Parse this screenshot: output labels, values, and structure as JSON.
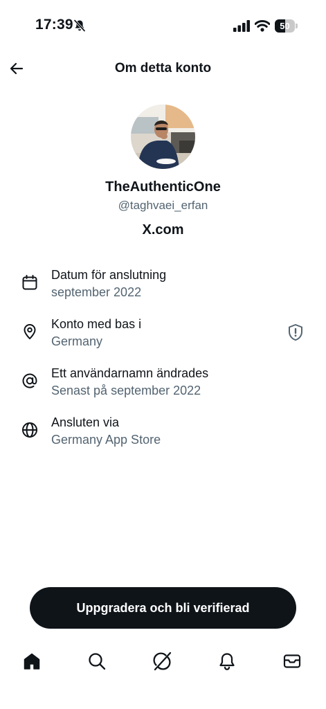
{
  "status_bar": {
    "time": "17:39",
    "battery_level": "50",
    "battery_fraction": 0.5,
    "icons": [
      "mute-bell-icon",
      "cellular-signal-icon",
      "wifi-icon",
      "battery-icon"
    ]
  },
  "header": {
    "title": "Om detta konto",
    "back_icon": "arrow-left-icon"
  },
  "profile": {
    "display_name": "TheAuthenticOne",
    "handle": "@taghvaei_erfan",
    "platform": "X.com"
  },
  "details": [
    {
      "icon": "calendar-icon",
      "title": "Datum för anslutning",
      "value": "september 2022"
    },
    {
      "icon": "location-pin-icon",
      "title": "Konto med bas i",
      "value": "Germany",
      "action_icon": "shield-alert-icon"
    },
    {
      "icon": "at-sign-icon",
      "title": "Ett användarnamn ändrades",
      "value": "Senast på september 2022"
    },
    {
      "icon": "globe-icon",
      "title": "Ansluten via",
      "value": "Germany App Store"
    }
  ],
  "cta": {
    "label": "Uppgradera och bli verifierad"
  },
  "bottom_nav": [
    {
      "icon": "home-icon",
      "active": true
    },
    {
      "icon": "search-icon",
      "active": false
    },
    {
      "icon": "grok-icon",
      "active": false
    },
    {
      "icon": "bell-icon",
      "active": false
    },
    {
      "icon": "mail-icon",
      "active": false
    }
  ],
  "colors": {
    "text_primary": "#0f1419",
    "text_secondary": "#536471",
    "button_bg": "#0f1419",
    "background": "#ffffff"
  }
}
